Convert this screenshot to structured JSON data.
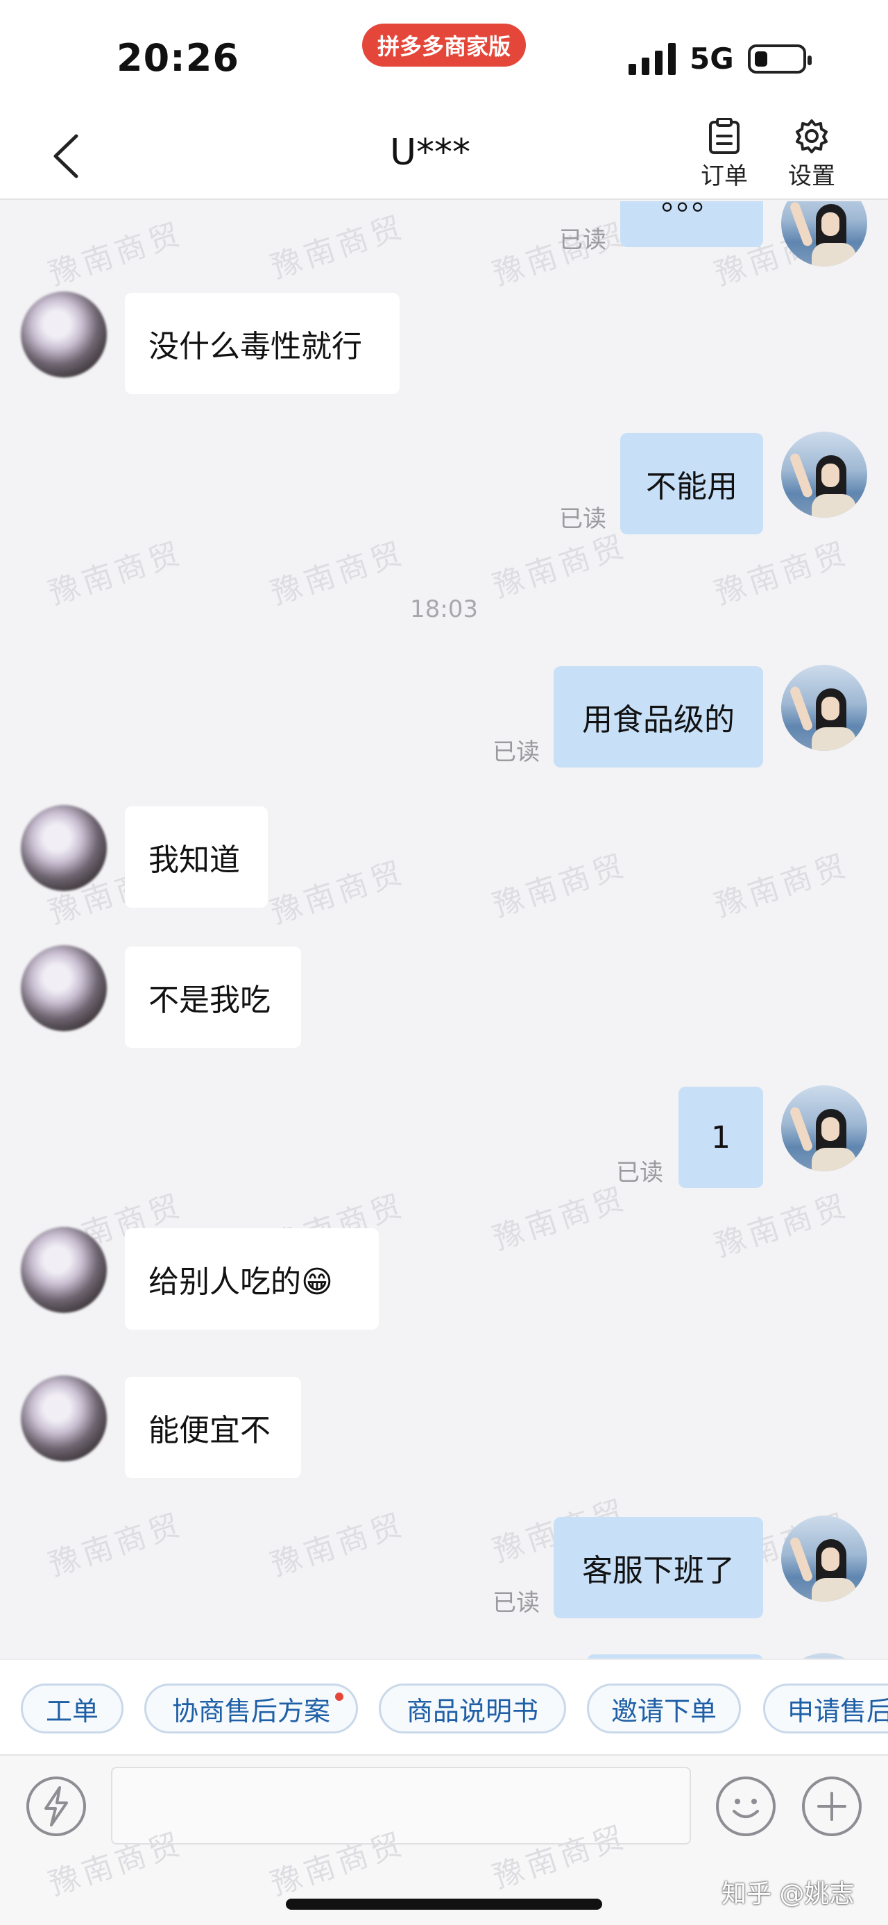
{
  "status_bar": {
    "time": "20:26",
    "app_badge": "拼多多商家版",
    "network": "5G"
  },
  "nav": {
    "title": "U***",
    "order_label": "订单",
    "settings_label": "设置"
  },
  "watermark": "豫南商贸",
  "messages": [
    {
      "side": "right",
      "text": "。。。",
      "read": "已读"
    },
    {
      "side": "left",
      "text": "没什么毒性就行"
    },
    {
      "side": "right",
      "text": "不能用",
      "read": "已读"
    },
    {
      "side": "time",
      "text": "18:03"
    },
    {
      "side": "right",
      "text": "用食品级的",
      "read": "已读"
    },
    {
      "side": "left",
      "text": "我知道"
    },
    {
      "side": "left",
      "text": "不是我吃"
    },
    {
      "side": "right",
      "text": "1",
      "read": "已读"
    },
    {
      "side": "left",
      "text": "给别人吃的😁"
    },
    {
      "side": "left",
      "text": "能便宜不"
    },
    {
      "side": "right",
      "text": "客服下班了",
      "read": "已读"
    }
  ],
  "shortcuts": [
    "工单",
    "协商售后方案",
    "商品说明书",
    "邀请下单",
    "申请售后"
  ],
  "input": {
    "value": "",
    "placeholder": ""
  },
  "credit": "知乎 @姚志"
}
